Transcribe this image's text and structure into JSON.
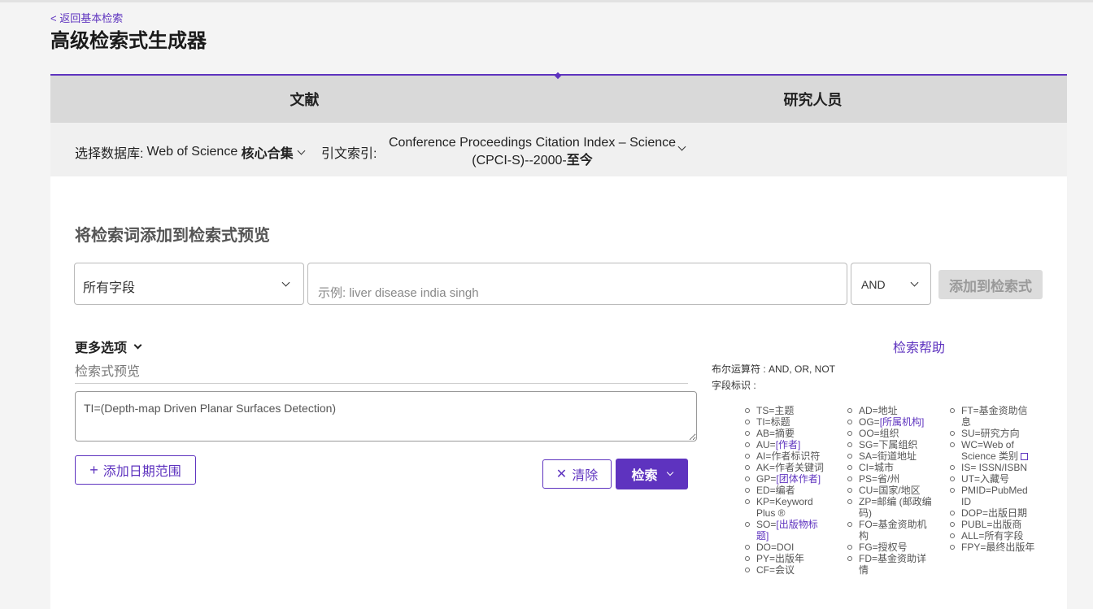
{
  "nav": {
    "back_link": "< 返回基本检索"
  },
  "page": {
    "title": "高级检索式生成器"
  },
  "tabs": [
    {
      "label": "文献"
    },
    {
      "label": "研究人员"
    }
  ],
  "database": {
    "label": "选择数据库:",
    "value_prefix": "Web of Science",
    "value_bold": "核心合集",
    "citation_label": "引文索引:",
    "citation_line1": "Conference Proceedings Citation Index – Science",
    "citation_line2_a": "(CPCI-S)--2000-",
    "citation_line2_b": "至今"
  },
  "builder": {
    "section_title": "将检索词添加到检索式预览",
    "field_select": "所有字段",
    "term_placeholder": "示例: liver disease india singh",
    "bool_select": "AND",
    "add_button": "添加到检索式",
    "more_options": "更多选项",
    "preview_label": "检索式预览",
    "preview_value": "TI=(Depth-map Driven Planar Surfaces Detection)",
    "date_button": "添加日期范围",
    "clear_button": "清除",
    "search_button": "检索"
  },
  "help": {
    "link": "检索帮助",
    "bool_ops": "布尔运算符 : AND, OR, NOT",
    "field_tags_label": "字段标识 :",
    "col1": [
      {
        "text": "TS=主题"
      },
      {
        "text": "TI=标题"
      },
      {
        "text": "AB=摘要"
      },
      {
        "pre": "AU=",
        "link": "[作者]"
      },
      {
        "text": "AI=作者标识符"
      },
      {
        "text": "AK=作者关键词"
      },
      {
        "pre": "GP=",
        "link": "[团体作者]"
      },
      {
        "text": "ED=编者"
      },
      {
        "text": "KP=Keyword Plus ®"
      },
      {
        "pre": "SO=",
        "link": "[出版物标题]"
      },
      {
        "text": "DO=DOI"
      },
      {
        "text": "PY=出版年"
      },
      {
        "text": "CF=会议"
      }
    ],
    "col2": [
      {
        "text": "AD=地址"
      },
      {
        "pre": "OG=",
        "link": "[所属机构]"
      },
      {
        "text": "OO=组织"
      },
      {
        "text": "SG=下属组织"
      },
      {
        "text": "SA=街道地址"
      },
      {
        "text": "CI=城市"
      },
      {
        "text": "PS=省/州"
      },
      {
        "text": "CU=国家/地区"
      },
      {
        "text": "ZP=邮编 (邮政编码)"
      },
      {
        "text": "FO=基金资助机构"
      },
      {
        "text": "FG=授权号"
      },
      {
        "text": "FD=基金资助详情"
      }
    ],
    "col3": [
      {
        "text": "FT=基金资助信息"
      },
      {
        "text": "SU=研究方向"
      },
      {
        "text": "WC=Web of Science 类别",
        "ext": true
      },
      {
        "text": "IS= ISSN/ISBN"
      },
      {
        "text": "UT=入藏号"
      },
      {
        "text": "PMID=PubMed ID"
      },
      {
        "text": "DOP=出版日期"
      },
      {
        "text": "PUBL=出版商"
      },
      {
        "text": "ALL=所有字段"
      },
      {
        "text": "FPY=最终出版年"
      }
    ]
  }
}
